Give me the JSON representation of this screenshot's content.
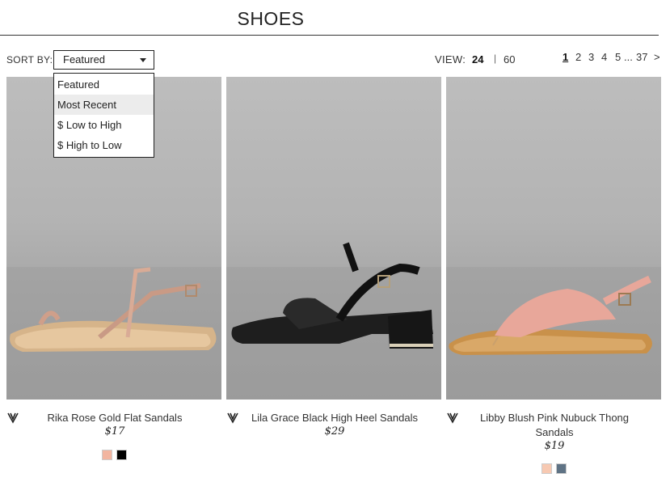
{
  "header": {
    "title": "SHOES"
  },
  "sort": {
    "label": "SORT BY:",
    "selected": "Featured",
    "options": [
      "Featured",
      "Most Recent",
      "$ Low to High",
      "$ High to Low"
    ],
    "hovered_option": "Most Recent"
  },
  "view": {
    "label": "VIEW:",
    "option_24": "24",
    "separator": "|",
    "option_60": "60",
    "selected": "24"
  },
  "pagination": {
    "pages": [
      "1",
      "2",
      "3",
      "4",
      "5"
    ],
    "ellipsis": "...",
    "last": "37",
    "next": ">",
    "current": "1"
  },
  "products": [
    {
      "name": "Rika Rose Gold Flat Sandals",
      "price": "$17",
      "swatches": [
        "#f2b5a0",
        "#000000"
      ]
    },
    {
      "name": "Lila Grace Black High Heel Sandals",
      "price": "$29",
      "swatches": []
    },
    {
      "name": "Libby Blush Pink Nubuck Thong Sandals",
      "price": "$19",
      "swatches": [
        "#f7c9b2",
        "#5f7385"
      ]
    }
  ],
  "icons": {
    "favorite": "heart-outline-icon",
    "dropdown": "caret-down-icon"
  }
}
